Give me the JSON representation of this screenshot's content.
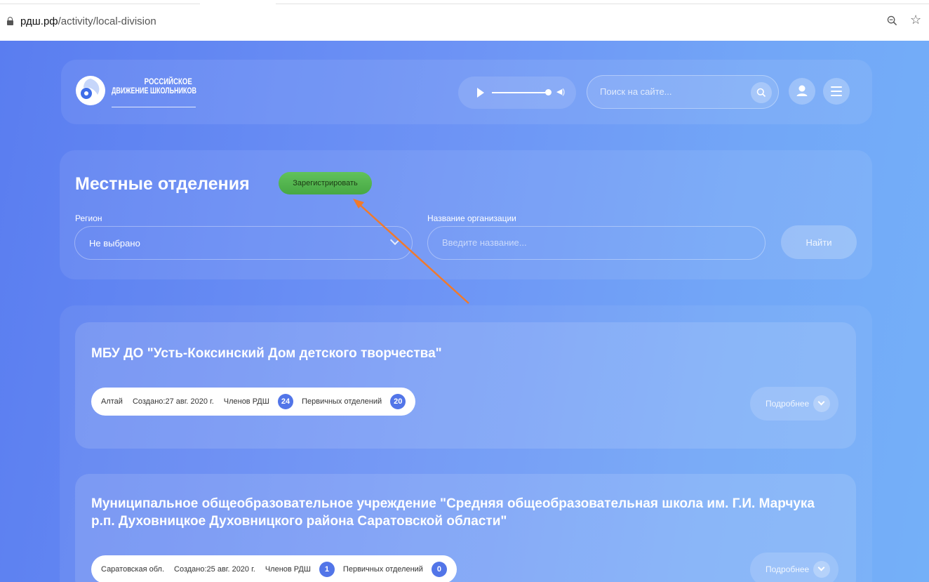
{
  "browser": {
    "url_host": "рдш.рф",
    "url_path": "/activity/local-division"
  },
  "header": {
    "logo_line1": "РОССИЙСКОЕ",
    "logo_line2": "ДВИЖЕНИЕ ШКОЛЬНИКОВ",
    "search_placeholder": "Поиск на сайте..."
  },
  "filters": {
    "title": "Местные отделения",
    "register_label": "Зарегистрировать",
    "region_label": "Регион",
    "region_value": "Не выбрано",
    "org_label": "Название организации",
    "org_placeholder": "Введите название...",
    "find_label": "Найти"
  },
  "results": [
    {
      "title": "МБУ ДО \"Усть-Коксинский Дом детского творчества\"",
      "region": "Алтай",
      "created": "Создано:27 авг. 2020 г.",
      "members_label": "Членов РДШ",
      "members_count": "24",
      "primary_label": "Первичных отделений",
      "primary_count": "20",
      "more_label": "Подробнее"
    },
    {
      "title": "Муниципальное общеобразовательное учреждение \"Средняя общеобразовательная школа им. Г.И. Марчука р.п. Духовницкое Духовницкого района Саратовской области\"",
      "region": "Саратовская обл.",
      "created": "Создано:25 авг. 2020 г.",
      "members_label": "Членов РДШ",
      "members_count": "1",
      "primary_label": "Первичных отделений",
      "primary_count": "0",
      "more_label": "Подробнее"
    }
  ],
  "colors": {
    "accent": "#5275e8",
    "register_green": "#4fb24b",
    "annotation_arrow": "#f07a2c"
  }
}
